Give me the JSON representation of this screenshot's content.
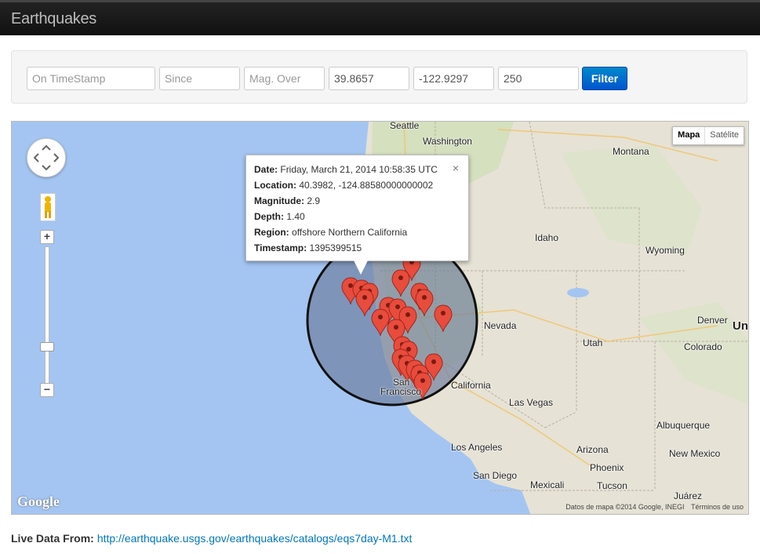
{
  "app": {
    "title": "Earthquakes"
  },
  "filters": {
    "timestamp_placeholder": "On TimeStamp",
    "since_placeholder": "Since",
    "magnitude_placeholder": "Mag. Over",
    "latitude_value": "39.8657",
    "longitude_value": "-122.9297",
    "radius_value": "250",
    "filter_label": "Filter"
  },
  "map": {
    "type_buttons": {
      "map": "Mapa",
      "satellite": "Satélite"
    },
    "labels": {
      "seattle": "Seattle",
      "washington": "Washington",
      "montana": "Montana",
      "idaho": "Idaho",
      "wyoming": "Wyoming",
      "nevada": "Nevada",
      "utah": "Utah",
      "colorado": "Colorado",
      "denver": "Denver",
      "california": "California",
      "san": "San",
      "francisco": "Francisco",
      "las_vegas": "Las Vegas",
      "los_angeles": "Los Angeles",
      "arizona": "Arizona",
      "phoenix": "Phoenix",
      "san_diego": "San Diego",
      "tucson": "Tucson",
      "mexicali": "Mexicali",
      "albuquerque": "Albuquerque",
      "new_mexico": "New Mexico",
      "juarez": "Juárez",
      "united_cut": "Un"
    },
    "google_logo": "Google",
    "footer": {
      "attribution": "Datos de mapa ©2014 Google, INEGI",
      "terms": "Términos de uso"
    },
    "zoom": {
      "in": "+",
      "out": "−"
    },
    "info_window": {
      "date_label": "Date:",
      "date_value": "Friday, March 21, 2014 10:58:35 UTC",
      "location_label": "Location:",
      "location_value": "40.3982, -124.88580000000002",
      "magnitude_label": "Magnitude:",
      "magnitude_value": "2.9",
      "depth_label": "Depth:",
      "depth_value": "1.40",
      "region_label": "Region:",
      "region_value": "offshore Northern California",
      "timestamp_label": "Timestamp:",
      "timestamp_value": "1395399515",
      "close": "×"
    },
    "colors": {
      "water": "#a4c5f2",
      "land": "#e8e4d8",
      "marker": "#e74c3c",
      "circle_fill": "#6a7a9a"
    }
  },
  "footer": {
    "live_label": "Live Data From:",
    "live_url": "http://earthquake.usgs.gov/earthquakes/catalogs/eqs7day-M1.txt"
  }
}
